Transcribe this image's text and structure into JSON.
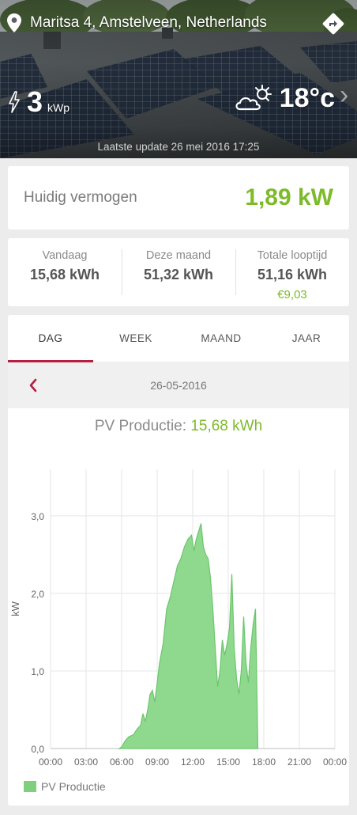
{
  "header": {
    "location": "Maritsa 4, Amstelveen, Netherlands",
    "capacity_value": "3",
    "capacity_unit": "kWp",
    "temperature": "18°c",
    "last_update": "Laatste update 26 mei 2016 17:25",
    "icons": [
      "location-pin-icon",
      "directions-icon",
      "lightning-icon",
      "partly-cloudy-icon",
      "chevron-right-icon"
    ]
  },
  "power": {
    "label": "Huidig vermogen",
    "value": "1,89 kW"
  },
  "stats": [
    {
      "label": "Vandaag",
      "value": "15,68 kWh"
    },
    {
      "label": "Deze maand",
      "value": "51,32 kWh"
    },
    {
      "label": "Totale looptijd",
      "value": "51,16 kWh",
      "extra": "€9,03"
    }
  ],
  "tabs": [
    {
      "label": "DAG",
      "active": true
    },
    {
      "label": "WEEK",
      "active": false
    },
    {
      "label": "MAAND",
      "active": false
    },
    {
      "label": "JAAR",
      "active": false
    }
  ],
  "date": "26-05-2016",
  "production": {
    "label": "PV Productie:",
    "value": "15,68 kWh"
  },
  "colors": {
    "accent_green": "#7dbb2a",
    "series_fill": "#8fd98f",
    "series_line": "#6cc56c",
    "active_tab": "#b51f3f"
  },
  "chart_data": {
    "type": "area",
    "ylabel": "kW",
    "xlabel": "",
    "ylim": [
      0,
      3.6
    ],
    "yticks": [
      "0,0",
      "1,0",
      "2,0",
      "3,0"
    ],
    "ytick_values": [
      0,
      1,
      2,
      3
    ],
    "xticks": [
      "00:00",
      "03:00",
      "06:00",
      "09:00",
      "12:00",
      "15:00",
      "18:00",
      "21:00",
      "00:00"
    ],
    "xlim_hours": [
      0,
      24
    ],
    "grid": true,
    "legend": "bottom-left",
    "series": [
      {
        "name": "PV Productie",
        "x_hours": [
          5.8,
          6.0,
          6.3,
          6.6,
          7.0,
          7.3,
          7.6,
          7.8,
          8.0,
          8.2,
          8.4,
          8.6,
          8.8,
          9.0,
          9.2,
          9.5,
          9.8,
          10.1,
          10.4,
          10.7,
          11.0,
          11.3,
          11.6,
          11.9,
          12.1,
          12.3,
          12.5,
          12.7,
          12.9,
          13.1,
          13.3,
          13.5,
          13.7,
          13.9,
          14.1,
          14.3,
          14.5,
          14.7,
          14.9,
          15.1,
          15.3,
          15.5,
          15.7,
          15.9,
          16.1,
          16.3,
          16.5,
          16.7,
          16.9,
          17.1,
          17.3,
          17.5
        ],
        "values": [
          0.0,
          0.02,
          0.1,
          0.15,
          0.18,
          0.25,
          0.3,
          0.45,
          0.35,
          0.5,
          0.7,
          0.75,
          0.6,
          0.85,
          1.1,
          1.35,
          1.8,
          1.95,
          2.15,
          2.35,
          2.45,
          2.6,
          2.7,
          2.75,
          2.55,
          2.7,
          2.8,
          2.9,
          2.6,
          2.5,
          2.45,
          2.2,
          1.8,
          1.3,
          0.8,
          1.0,
          1.4,
          1.2,
          1.35,
          1.55,
          2.25,
          1.3,
          0.9,
          0.7,
          1.0,
          1.7,
          1.1,
          0.85,
          1.3,
          1.6,
          1.8,
          0.0
        ]
      }
    ]
  }
}
